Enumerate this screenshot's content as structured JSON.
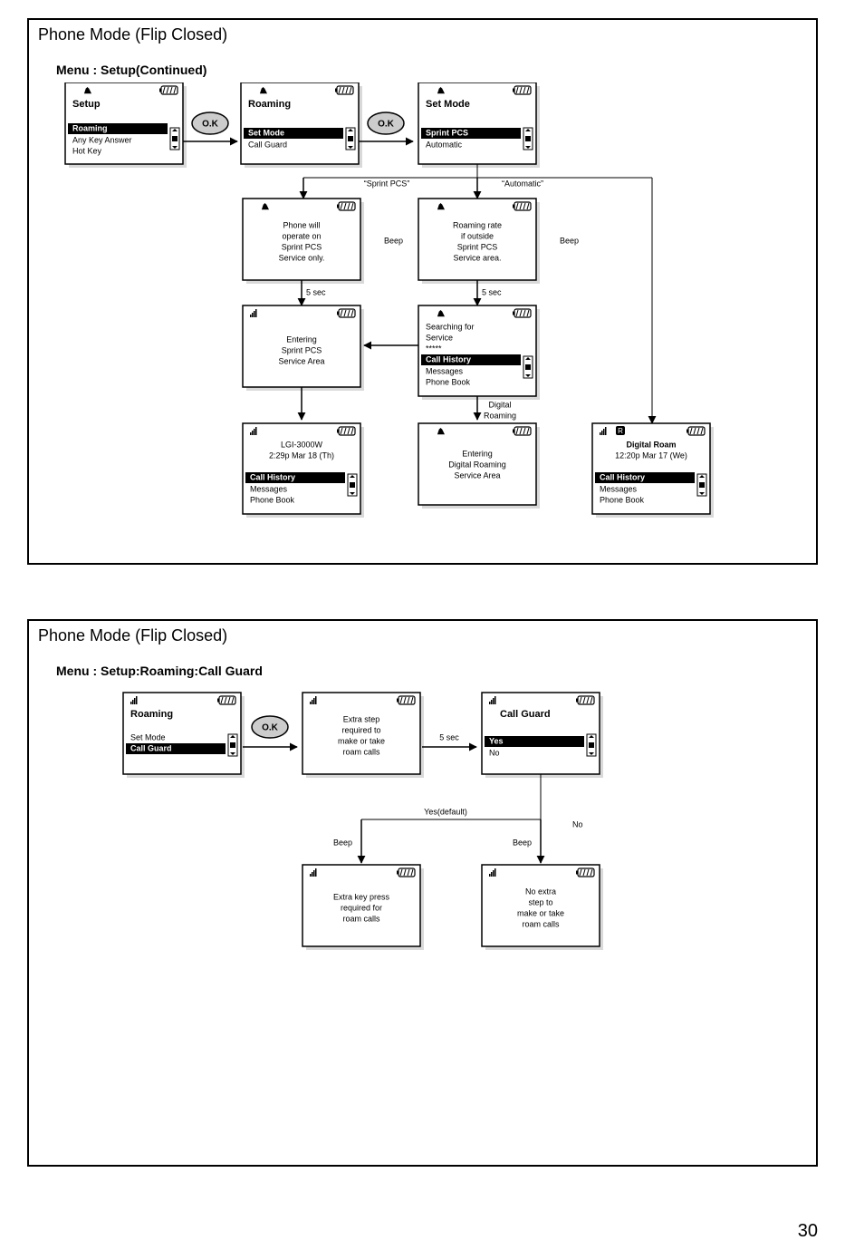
{
  "page_number": "30",
  "panel1": {
    "title": "Phone Mode (Flip Closed)",
    "subtitle": "Menu : Setup(Continued)",
    "screens": {
      "setup": {
        "title": "Setup",
        "sel": "Roaming",
        "row2": "Any Key Answer",
        "row3": "Hot Key"
      },
      "roaming": {
        "title": "Roaming",
        "sel": "Set Mode",
        "row2": "Call Guard"
      },
      "setmode": {
        "title": "Set Mode",
        "sel": "Sprint PCS",
        "row2": "Automatic"
      },
      "sprint_msg": {
        "l1": "Phone will",
        "l2": "operate on",
        "l3": "Sprint PCS",
        "l4": "Service only."
      },
      "auto_msg": {
        "l1": "Roaming rate",
        "l2": "if outside",
        "l3": "Sprint PCS",
        "l4": "Service area."
      },
      "entering_spcs": {
        "l1": "Entering",
        "l2": "Sprint PCS",
        "l3": "Service Area"
      },
      "searching": {
        "l1": "Searching for",
        "l2": "Service",
        "l3": "*****",
        "sel": "Call History",
        "row2": "Messages",
        "row3": "Phone Book"
      },
      "lgi": {
        "l1": "LGI-3000W",
        "l2": "2:29p Mar 18 (Th)",
        "sel": "Call History",
        "row2": "Messages",
        "row3": "Phone Book"
      },
      "entering_dig": {
        "l1": "Entering",
        "l2": "Digital Roaming",
        "l3": "Service Area"
      },
      "digroam": {
        "l1": "Digital Roam",
        "l2": "12:20p Mar 17 (We)",
        "sel": "Call History",
        "row2": "Messages",
        "row3": "Phone Book"
      }
    },
    "labels": {
      "ok": "O.K",
      "sprintpcs": "“Sprint PCS”",
      "automatic": "“Automatic”",
      "beep": "Beep",
      "5sec": "5 sec",
      "digital_roaming": "Digital\nRoaming"
    }
  },
  "panel2": {
    "title": "Phone Mode (Flip Closed)",
    "subtitle": "Menu : Setup:Roaming:Call Guard",
    "screens": {
      "roaming": {
        "title": "Roaming",
        "row1": "Set Mode",
        "sel": "Call Guard"
      },
      "extra_msg": {
        "l1": "Extra step",
        "l2": "required to",
        "l3": "make or take",
        "l4": "roam calls"
      },
      "callguard": {
        "title": "Call Guard",
        "sel": "Yes",
        "row2": "No"
      },
      "extra_key": {
        "l1": "Extra key press",
        "l2": "required for",
        "l3": "roam calls"
      },
      "noextra": {
        "l1": "No extra",
        "l2": "step to",
        "l3": "make or take",
        "l4": "roam calls"
      }
    },
    "labels": {
      "ok": "O.K",
      "5sec": "5 sec",
      "yesdefault": "Yes(default)",
      "no": "No",
      "beep": "Beep"
    }
  }
}
